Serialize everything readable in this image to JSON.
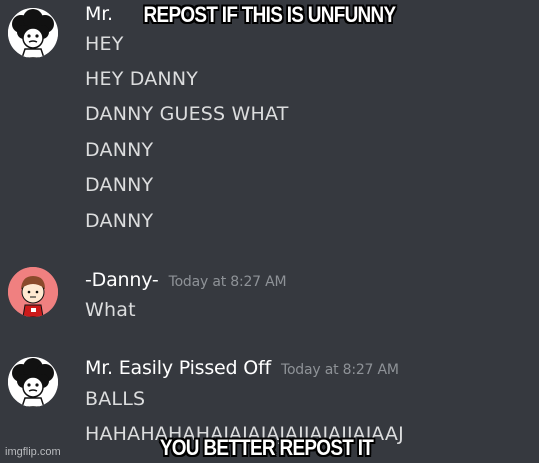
{
  "meme": {
    "top_caption": "REPOST IF THIS IS UNFUNNY",
    "bottom_caption": "YOU BETTER REPOST IT",
    "watermark": "imgflip.com"
  },
  "chat": {
    "group1": {
      "username": "Mr.",
      "lines": [
        "HEY",
        "HEY DANNY",
        "DANNY GUESS WHAT",
        "DANNY",
        "DANNY",
        "DANNY"
      ]
    },
    "group2": {
      "username": "-Danny-",
      "timestamp": "Today at 8:27 AM",
      "lines": [
        "What"
      ]
    },
    "group3": {
      "username": "Mr. Easily Pissed Off",
      "timestamp": "Today at 8:27 AM",
      "lines": [
        "BALLS",
        "HAHAHAHAHAJAJAJAJAJJAJAJJAJAAJ"
      ]
    }
  },
  "colors": {
    "background": "#36393f",
    "username": "#ffffff",
    "message_text": "#dcddde",
    "timestamp": "#8e9297",
    "danny_avatar_bg": "#f08080"
  }
}
